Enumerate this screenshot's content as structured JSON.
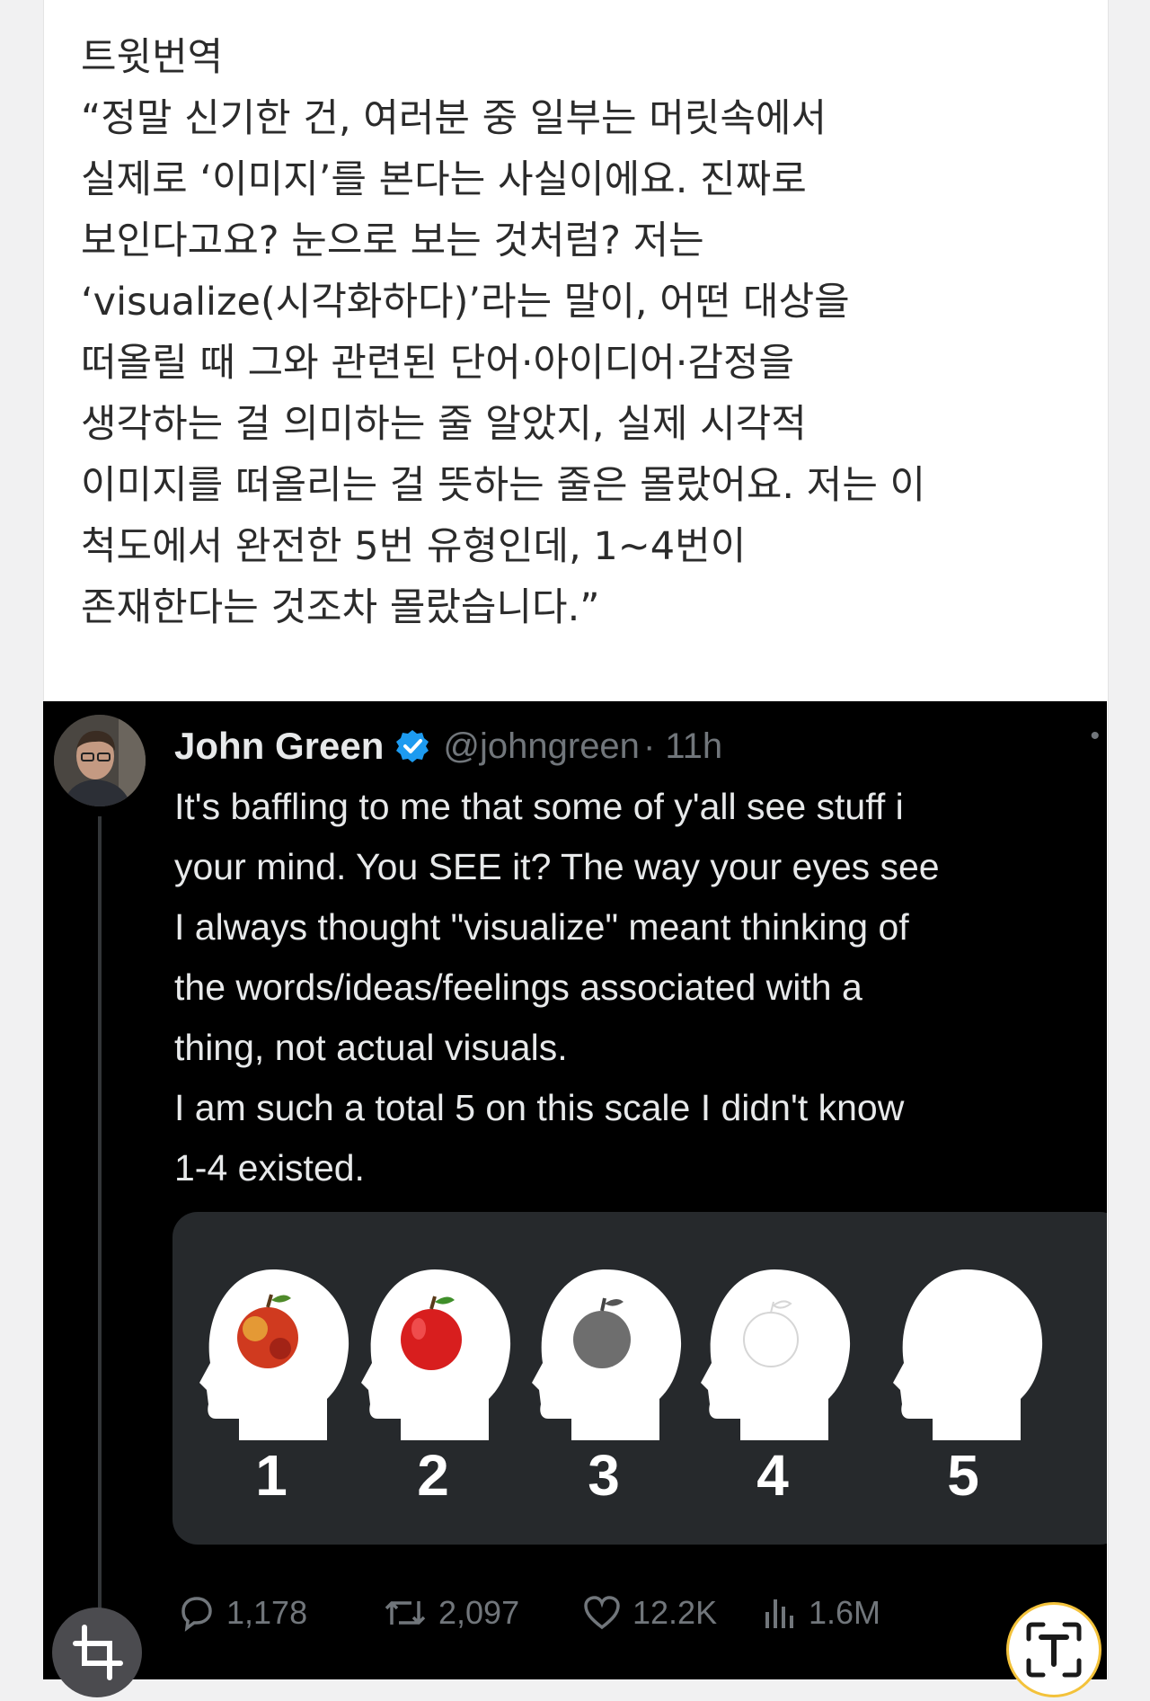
{
  "caption": {
    "lines": [
      "트윗번역",
      "“정말 신기한 건, 여러분 중 일부는 머릿속에서",
      "실제로 ‘이미지’를 본다는 사실이에요. 진짜로",
      "보인다고요? 눈으로 보는 것처럼? 저는",
      "‘visualize(시각화하다)’라는 말이, 어떤 대상을",
      "떠올릴 때 그와 관련된 단어·아이디어·감정을",
      "생각하는 걸 의미하는 줄 알았지, 실제 시각적",
      "이미지를 떠올리는 걸 뜻하는 줄은 몰랐어요. 저는 이",
      "척도에서 완전한 5번 유형인데, 1~4번이",
      "존재한다는 것조차 몰랐습니다.”"
    ]
  },
  "tweet": {
    "author": "John Green",
    "handle": "@johngreen",
    "time": "· 11h",
    "more_icon": "more-dots-icon",
    "body_lines": [
      "It's baffling to me that some of y'all see stuff i",
      "your mind. You SEE it? The way your eyes see",
      "I always thought \"visualize\" meant thinking of",
      "the words/ideas/feelings associated with a",
      "thing, not actual visuals.",
      "I am such a total 5 on this scale I didn't know",
      "1-4 existed."
    ],
    "scale": {
      "labels": [
        "1",
        "2",
        "3",
        "4",
        "5"
      ],
      "levels": [
        "vivid color apple",
        "clear red apple",
        "dim grey apple",
        "faint outline apple",
        "no image"
      ]
    },
    "stats": {
      "replies": "1,178",
      "reposts": "2,097",
      "likes": "12.2K",
      "views": "1.6M"
    }
  },
  "colors": {
    "tweet_background": "#000000",
    "panel_background": "#26292c",
    "verified_blue": "#1d9bf0",
    "muted_text": "#71767b",
    "lens_accent": "#f3c23b"
  }
}
